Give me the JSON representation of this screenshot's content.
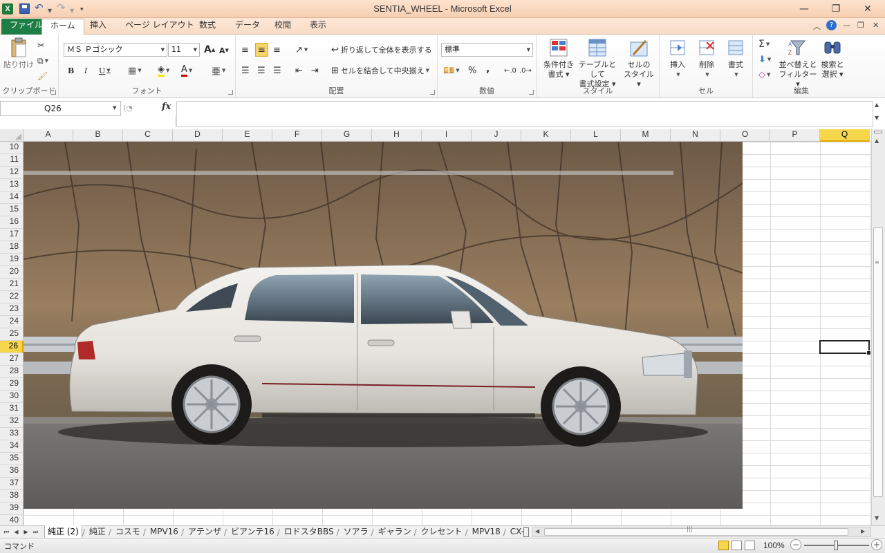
{
  "window": {
    "title": "SENTIA_WHEEL - Microsoft Excel",
    "app_icon_letter": "X",
    "controls": {
      "minimize": "—",
      "restore": "❐",
      "close": "✕"
    }
  },
  "ribbon_tabs": [
    "ファイル",
    "ホーム",
    "挿入",
    "ページ レイアウト",
    "数式",
    "データ",
    "校閲",
    "表示"
  ],
  "ribbon": {
    "clipboard": {
      "label": "クリップボード",
      "paste": "貼り付け"
    },
    "font": {
      "label": "フォント",
      "font_name": "ＭＳ Ｐゴシック",
      "font_size": "11",
      "bold": "B",
      "italic": "I",
      "underline": "U",
      "grow": "A",
      "shrink": "A"
    },
    "alignment": {
      "label": "配置",
      "wrap": "折り返して全体を表示する",
      "merge": "セルを結合して中央揃え"
    },
    "number": {
      "label": "数値",
      "format": "標準",
      "percent": "%",
      "comma": ","
    },
    "styles": {
      "label": "スタイル",
      "conditional": [
        "条件付き",
        "書式"
      ],
      "table": [
        "テーブルとして",
        "書式設定"
      ],
      "cell_styles": [
        "セルの",
        "スタイル"
      ]
    },
    "cells": {
      "label": "セル",
      "insert": "挿入",
      "delete": "削除",
      "format": "書式"
    },
    "editing": {
      "label": "編集",
      "sum": "Σ",
      "sort": [
        "並べ替えと",
        "フィルター"
      ],
      "find": [
        "検索と",
        "選択"
      ]
    }
  },
  "formula_bar": {
    "name_box": "Q26",
    "fx": "fx",
    "value": ""
  },
  "grid": {
    "columns": [
      "A",
      "B",
      "C",
      "D",
      "E",
      "F",
      "G",
      "H",
      "I",
      "J",
      "K",
      "L",
      "M",
      "N",
      "O",
      "P",
      "Q"
    ],
    "rows": [
      10,
      11,
      12,
      13,
      14,
      15,
      16,
      17,
      18,
      19,
      20,
      21,
      22,
      23,
      24,
      25,
      26,
      27,
      28,
      29,
      30,
      31,
      32,
      33,
      34,
      35,
      36,
      37,
      38,
      39,
      40
    ],
    "selected_column": "Q",
    "selected_row": 26
  },
  "sheet_tabs": [
    "純正 (2)",
    "純正",
    "コスモ",
    "MPV16",
    "アテンザ",
    "ビアンテ16",
    "ロドスタBBS",
    "ソアラ",
    "ギャラン",
    "クレセント",
    "MPV18",
    "CX-"
  ],
  "active_sheet": "純正 (2)",
  "status": {
    "mode": "コマンド",
    "zoom": "100%"
  }
}
